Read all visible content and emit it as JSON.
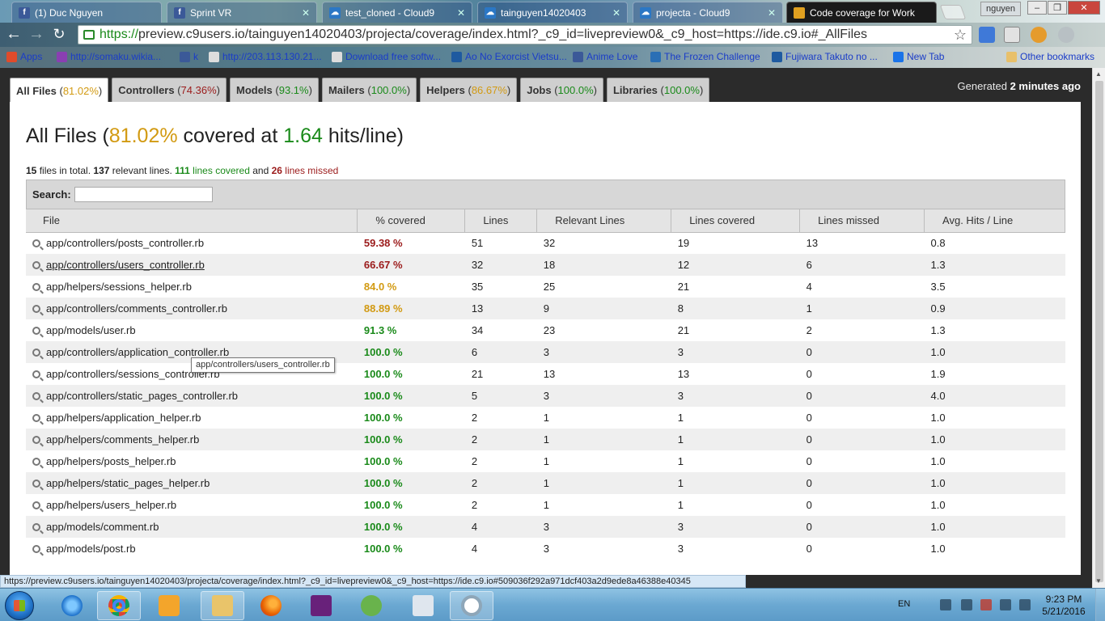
{
  "browser": {
    "tabs": [
      {
        "title": "(1) Duc Nguyen",
        "icon": "facebook-icon"
      },
      {
        "title": "Sprint VR",
        "icon": "facebook-icon"
      },
      {
        "title": "test_cloned - Cloud9",
        "icon": "cloud9-icon"
      },
      {
        "title": "tainguyen14020403",
        "icon": "cloud9-icon"
      },
      {
        "title": "projecta - Cloud9",
        "icon": "cloud9-icon"
      },
      {
        "title": "Code coverage for Work",
        "icon": "coverage-icon"
      }
    ],
    "user_badge": "nguyen",
    "window_controls": {
      "minimize": "–",
      "restore": "❐",
      "close": "✕"
    },
    "url_scheme": "https://",
    "url_rest": "preview.c9users.io/tainguyen14020403/projecta/coverage/index.html?_c9_id=livepreview0&_c9_host=https://ide.c9.io#_AllFiles",
    "bookmarks": [
      {
        "label": "Apps",
        "color": "#e04b2b"
      },
      {
        "label": "http://somaku.wikia...",
        "color": "#8a3fb2"
      },
      {
        "label": "k",
        "color": "#3b5998"
      },
      {
        "label": "http://203.113.130.21...",
        "color": "#cccccc"
      },
      {
        "label": "Download free softw...",
        "color": "#cccccc"
      },
      {
        "label": "Ao No Exorcist Vietsu...",
        "color": "#1e5aa0"
      },
      {
        "label": "Anime Love",
        "color": "#3b5998"
      },
      {
        "label": "The Frozen Challenge",
        "color": "#2a6fb5"
      },
      {
        "label": "Fujiwara Takuto no ...",
        "color": "#1e5aa0"
      },
      {
        "label": "New Tab",
        "color": "#1a73e8"
      },
      {
        "label": "Other bookmarks",
        "color": "#e8c06a"
      }
    ]
  },
  "page": {
    "generated_prefix": "Generated ",
    "generated_time": "2 minutes ago",
    "categories": [
      {
        "name": "All Files",
        "pct": "81.02%",
        "color": "yellow"
      },
      {
        "name": "Controllers",
        "pct": "74.36%",
        "color": "red"
      },
      {
        "name": "Models",
        "pct": "93.1%",
        "color": "green"
      },
      {
        "name": "Mailers",
        "pct": "100.0%",
        "color": "green"
      },
      {
        "name": "Helpers",
        "pct": "86.67%",
        "color": "yellow"
      },
      {
        "name": "Jobs",
        "pct": "100.0%",
        "color": "green"
      },
      {
        "name": "Libraries",
        "pct": "100.0%",
        "color": "green"
      }
    ],
    "title_prefix": "All Files (",
    "title_pct": "81.02%",
    "title_mid": " covered at ",
    "title_hits": "1.64",
    "title_suffix": " hits/line)",
    "summary": {
      "files": "15",
      "files_text": " files in total. ",
      "relevant": "137",
      "relevant_text": " relevant lines. ",
      "covered": "111",
      "covered_text": " lines covered",
      "and_text": " and ",
      "missed": "26",
      "missed_text": " lines missed"
    },
    "search_label": "Search:",
    "search_value": "",
    "columns": [
      "File",
      "% covered",
      "Lines",
      "Relevant Lines",
      "Lines covered",
      "Lines missed",
      "Avg. Hits / Line"
    ],
    "rows": [
      {
        "file": "app/controllers/posts_controller.rb",
        "pct": "59.38 %",
        "color": "red",
        "lines": "51",
        "relevant": "32",
        "covered": "19",
        "missed": "13",
        "avg": "0.8"
      },
      {
        "file": "app/controllers/users_controller.rb",
        "pct": "66.67 %",
        "color": "red",
        "lines": "32",
        "relevant": "18",
        "covered": "12",
        "missed": "6",
        "avg": "1.3"
      },
      {
        "file": "app/helpers/sessions_helper.rb",
        "pct": "84.0 %",
        "color": "yellow",
        "lines": "35",
        "relevant": "25",
        "covered": "21",
        "missed": "4",
        "avg": "3.5"
      },
      {
        "file": "app/controllers/comments_controller.rb",
        "pct": "88.89 %",
        "color": "yellow",
        "lines": "13",
        "relevant": "9",
        "covered": "8",
        "missed": "1",
        "avg": "0.9"
      },
      {
        "file": "app/models/user.rb",
        "pct": "91.3 %",
        "color": "green",
        "lines": "34",
        "relevant": "23",
        "covered": "21",
        "missed": "2",
        "avg": "1.3"
      },
      {
        "file": "app/controllers/application_controller.rb",
        "pct": "100.0 %",
        "color": "green",
        "lines": "6",
        "relevant": "3",
        "covered": "3",
        "missed": "0",
        "avg": "1.0"
      },
      {
        "file": "app/controllers/sessions_controller.rb",
        "pct": "100.0 %",
        "color": "green",
        "lines": "21",
        "relevant": "13",
        "covered": "13",
        "missed": "0",
        "avg": "1.9"
      },
      {
        "file": "app/controllers/static_pages_controller.rb",
        "pct": "100.0 %",
        "color": "green",
        "lines": "5",
        "relevant": "3",
        "covered": "3",
        "missed": "0",
        "avg": "4.0"
      },
      {
        "file": "app/helpers/application_helper.rb",
        "pct": "100.0 %",
        "color": "green",
        "lines": "2",
        "relevant": "1",
        "covered": "1",
        "missed": "0",
        "avg": "1.0"
      },
      {
        "file": "app/helpers/comments_helper.rb",
        "pct": "100.0 %",
        "color": "green",
        "lines": "2",
        "relevant": "1",
        "covered": "1",
        "missed": "0",
        "avg": "1.0"
      },
      {
        "file": "app/helpers/posts_helper.rb",
        "pct": "100.0 %",
        "color": "green",
        "lines": "2",
        "relevant": "1",
        "covered": "1",
        "missed": "0",
        "avg": "1.0"
      },
      {
        "file": "app/helpers/static_pages_helper.rb",
        "pct": "100.0 %",
        "color": "green",
        "lines": "2",
        "relevant": "1",
        "covered": "1",
        "missed": "0",
        "avg": "1.0"
      },
      {
        "file": "app/helpers/users_helper.rb",
        "pct": "100.0 %",
        "color": "green",
        "lines": "2",
        "relevant": "1",
        "covered": "1",
        "missed": "0",
        "avg": "1.0"
      },
      {
        "file": "app/models/comment.rb",
        "pct": "100.0 %",
        "color": "green",
        "lines": "4",
        "relevant": "3",
        "covered": "3",
        "missed": "0",
        "avg": "1.0"
      },
      {
        "file": "app/models/post.rb",
        "pct": "100.0 %",
        "color": "green",
        "lines": "4",
        "relevant": "3",
        "covered": "3",
        "missed": "0",
        "avg": "1.0"
      }
    ],
    "tooltip": "app/controllers/users_controller.rb",
    "status_url": "https://preview.c9users.io/tainguyen14020403/projecta/coverage/index.html?_c9_id=livepreview0&_c9_host=https://ide.c9.io#509036f292a971dcf403a2d9ede8a46388e40345"
  },
  "taskbar": {
    "apps": [
      "internet-explorer-icon",
      "chrome-icon",
      "media-player-icon",
      "file-explorer-icon",
      "firefox-icon",
      "visual-studio-icon",
      "snipping-tool-icon",
      "keyboard-icon",
      "opera-icon"
    ],
    "language": "EN",
    "time": "9:23 PM",
    "date": "5/21/2016"
  },
  "colors": {
    "green": "#1a8a1a",
    "yellow": "#d29a12",
    "red": "#9b1b1b"
  }
}
